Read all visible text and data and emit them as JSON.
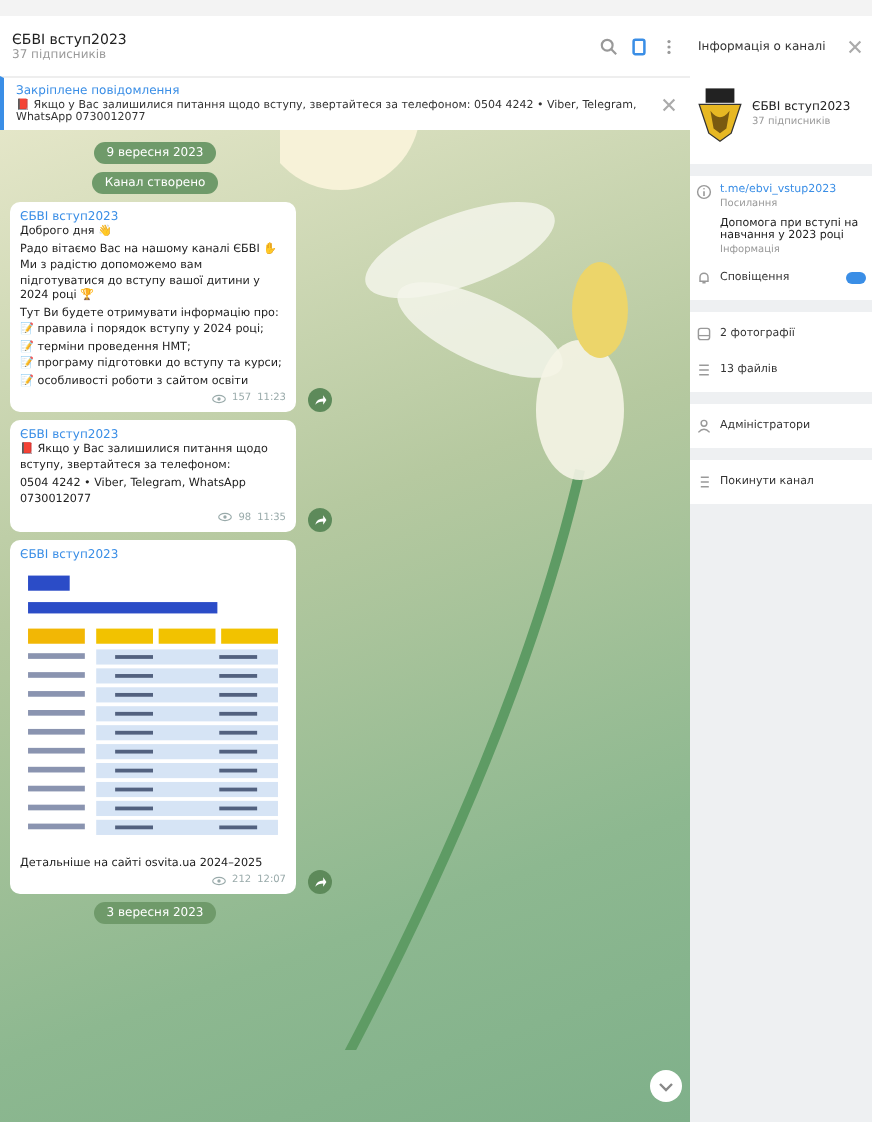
{
  "header": {
    "title": "ЄБВІ вступ2023",
    "subtitle": "37 підписників"
  },
  "pinned": {
    "label": "Закріплене повідомлення",
    "text": "📕 Якщо у Вас залишилися питання щодо вступу, звертайтеся за телефоном: 0504 4242 • Viber, Telegram, WhatsApp 0730012077"
  },
  "messages": [
    {
      "kind": "date",
      "text": "9 вересня 2023"
    },
    {
      "kind": "date",
      "text": "Канал створено"
    },
    {
      "kind": "post",
      "sender": "ЄБВІ вступ2023",
      "lines": [
        "Доброго дня 👋",
        "Радо вітаємо Вас на нашому каналі ЄБВІ ✋",
        "Ми з радістю допоможемо вам підготуватися до вступу вашої дитини у 2024 році 🏆",
        "Тут Ви будете отримувати інформацію про:",
        "📝 правила і порядок вступу у 2024 році;",
        "📝 терміни проведення НМТ;",
        "📝 програму підготовки до вступу та курси;",
        "📝 особливості роботи з сайтом освіти"
      ],
      "views": "157",
      "time": "11:23"
    },
    {
      "kind": "post",
      "sender": "ЄБВІ вступ2023",
      "lines": [
        "📕 Якщо у Вас залишилися питання щодо вступу, звертайтеся за телефоном:",
        "0504 4242 • Viber, Telegram, WhatsApp",
        "0730012077"
      ],
      "views": "98",
      "time": "11:35"
    },
    {
      "kind": "photo",
      "sender": "ЄБВІ вступ2023",
      "lines": [
        "Детальніше на сайті osvita.ua 2024–2025"
      ],
      "views": "212",
      "time": "12:07"
    },
    {
      "kind": "date",
      "text": "3 вересня 2023"
    }
  ],
  "info_panel": {
    "title": "Інформація о каналі",
    "name": "ЄБВІ вступ2023",
    "subscribers": "37 підписників",
    "link": "t.me/ebvi_vstup2023",
    "link_label": "Посилання",
    "description": "Допомога при вступі на навчання у 2023 році",
    "description_label": "Інформація",
    "notifications": {
      "label": "Сповіщення",
      "on": true
    },
    "groups": [
      [
        {
          "kind": "photos",
          "label": "2 фотографії"
        },
        {
          "kind": "files",
          "label": "13 файлів"
        }
      ],
      [
        {
          "kind": "members",
          "label": "Адміністратори"
        }
      ],
      [
        {
          "kind": "leave",
          "label": "Покинути канал"
        }
      ]
    ]
  }
}
